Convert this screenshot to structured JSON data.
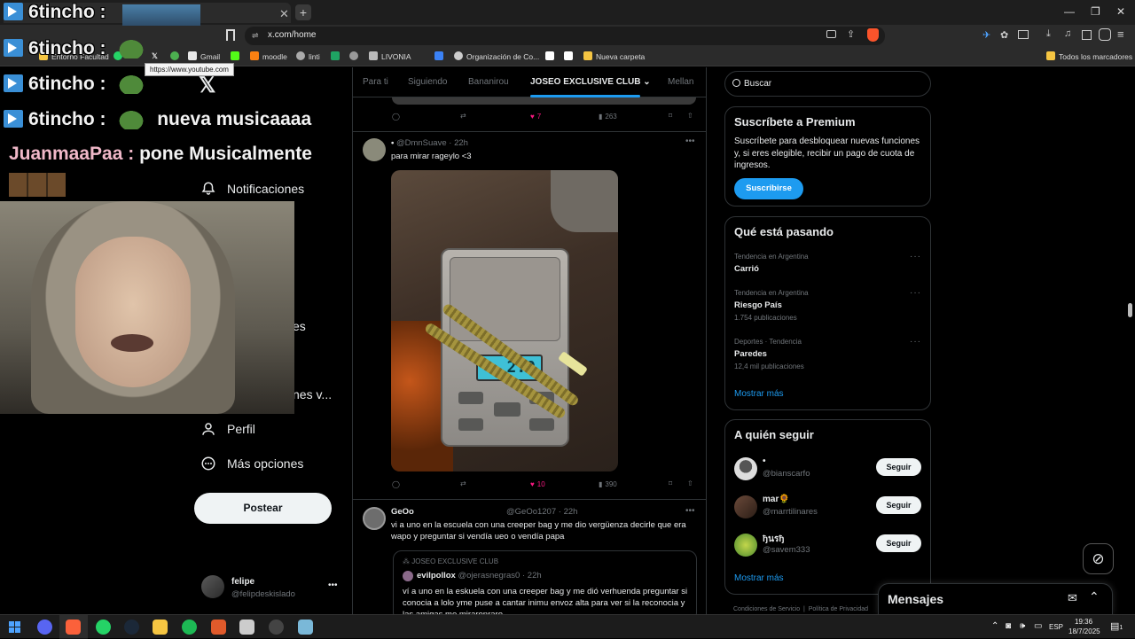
{
  "browser": {
    "tab_title": "",
    "url": "x.com/home",
    "tooltip": "https://www.youtube.com",
    "bookmarks": [
      {
        "label": "Entorno Facultad",
        "color": "#f5c542"
      },
      {
        "label": "",
        "color": "#25d366"
      },
      {
        "label": "",
        "color": "#ffffff"
      },
      {
        "label": "",
        "color": "#4caf50"
      },
      {
        "label": "Gmail",
        "color": "#e8e8e8"
      },
      {
        "label": "",
        "color": "#53fc18"
      },
      {
        "label": "moodle",
        "color": "#f98012"
      },
      {
        "label": "linti",
        "color": "#aaaaaa"
      },
      {
        "label": "",
        "color": "#1fa463"
      },
      {
        "label": "",
        "color": "#999999"
      },
      {
        "label": "LIVONIA",
        "color": "#bbbbbb"
      },
      {
        "label": "",
        "color": "#3b82f6"
      },
      {
        "label": "Organización de Co...",
        "color": "#cccccc"
      },
      {
        "label": "",
        "color": "#ffffff"
      },
      {
        "label": "",
        "color": "#ffffff"
      },
      {
        "label": "Nueva carpeta",
        "color": "#f5c542"
      }
    ],
    "all_bookmarks": "Todos los marcadores"
  },
  "overlay": {
    "chat": [
      {
        "user": "6tincho :",
        "message": ""
      },
      {
        "user": "6tincho :",
        "message": ""
      },
      {
        "user": "6tincho :",
        "message": ""
      },
      {
        "user": "6tincho :",
        "message": "nueva musicaaaa"
      },
      {
        "user": "JuanmaaPaa :",
        "message": "pone Musicalmente"
      }
    ]
  },
  "nav": {
    "notifications": "Notificaciones",
    "partial_1": "es",
    "partial_2": "nes v...",
    "profile": "Perfil",
    "more": "Más opciones",
    "post_button": "Postear",
    "account_name": "felipe",
    "account_handle": "@felipdeskislado"
  },
  "tabs": [
    "Para ti",
    "Siguiendo",
    "Bananirou",
    "JOSEO EXCLUSIVE CLUB",
    "Mellan"
  ],
  "posts": [
    {
      "replies": "",
      "reposts": "",
      "likes": "7",
      "views": "263"
    },
    {
      "name": "•",
      "handle": "@DmnSuave",
      "time": "22h",
      "text": "para mirar rageylo <3",
      "image_scale_reading": "2.0",
      "likes": "10",
      "views": "390"
    },
    {
      "name": "GeOo",
      "handle": "@GeOo1207",
      "time": "22h",
      "text": "vi a uno en la escuela con una creeper bag y me dio vergüenza decirle que era wapo y preguntar si vendía ueo o vendía papa",
      "quote": {
        "community": "JOSEO EXCLUSIVE CLUB",
        "name": "evilpollox",
        "handle": "@ojerasnegras0",
        "time": "22h",
        "text": "ví a uno en la eskuela con una creeper bag y me dió verhuenda preguntar si conocia a lolo yme puse a cantar inimu envoz alta para ver si la reconocia y las amigas me miraronraro"
      }
    }
  ],
  "right": {
    "search_placeholder": "Buscar",
    "premium": {
      "title": "Suscríbete a Premium",
      "text": "Suscríbete para desbloquear nuevas funciones y, si eres elegible, recibir un pago de cuota de ingresos.",
      "button": "Suscribirse"
    },
    "trends": {
      "title": "Qué está pasando",
      "items": [
        {
          "context": "Tendencia en Argentina",
          "name": "Carrió",
          "count": ""
        },
        {
          "context": "Tendencia en Argentina",
          "name": "Riesgo País",
          "count": "1.754 publicaciones"
        },
        {
          "context": "Deportes · Tendencia",
          "name": "Paredes",
          "count": "12,4 mil publicaciones"
        }
      ],
      "show_more": "Mostrar más"
    },
    "who_to_follow": {
      "title": "A quién seguir",
      "items": [
        {
          "name": "•",
          "handle": "@bianscarfo",
          "button": "Seguir"
        },
        {
          "name": "mar🌻",
          "handle": "@marrtilinares",
          "button": "Seguir"
        },
        {
          "name": "ђนรђ",
          "handle": "@savem333",
          "button": "Seguir"
        }
      ],
      "show_more": "Mostrar más"
    },
    "footer": [
      "Condiciones de Servicio",
      "Política de Privacidad"
    ]
  },
  "messages": {
    "title": "Mensajes"
  },
  "taskbar": {
    "lang": "ESP",
    "time": "19:36",
    "date": "18/7/2025",
    "notif_count": "1"
  }
}
